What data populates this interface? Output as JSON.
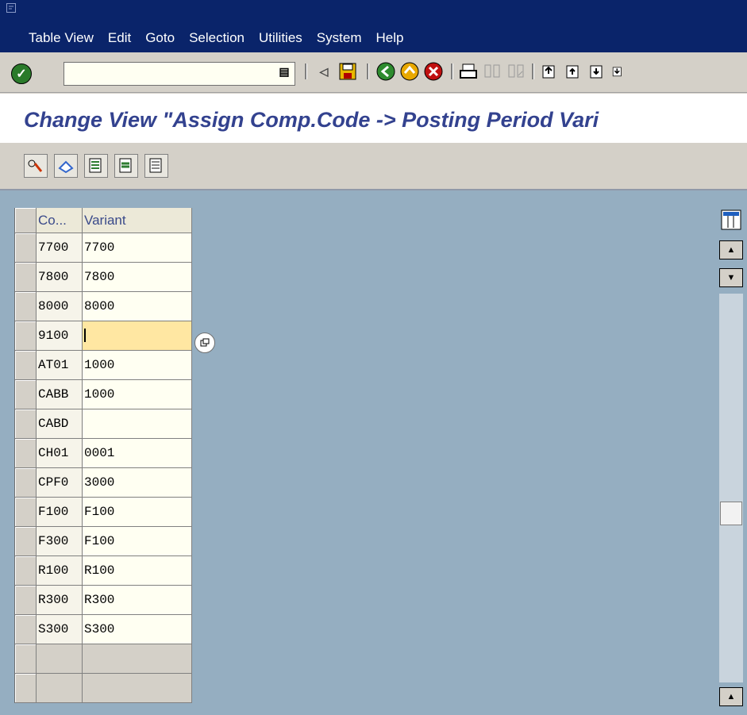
{
  "menubar": {
    "items": [
      "Table View",
      "Edit",
      "Goto",
      "Selection",
      "Utilities",
      "System",
      "Help"
    ]
  },
  "toolbar": {
    "command_value": "",
    "icons": [
      "check-icon",
      "history-icon",
      "back-triangle-icon",
      "save-icon",
      "back-icon",
      "exit-icon",
      "cancel-icon",
      "print-icon",
      "find-icon",
      "find-next-icon",
      "first-page-icon",
      "prev-page-icon",
      "next-page-icon",
      "last-page-icon"
    ]
  },
  "title": "Change View \"Assign Comp.Code -> Posting Period Vari",
  "app_toolbar": {
    "icons": [
      "edit-glasses-icon",
      "undo-icon",
      "select-all-icon",
      "select-block-icon",
      "deselect-all-icon"
    ]
  },
  "table": {
    "headers": [
      "Co...",
      "Variant"
    ],
    "rows": [
      [
        "7700",
        "7700"
      ],
      [
        "7800",
        "7800"
      ],
      [
        "8000",
        "8000"
      ],
      [
        "9100",
        ""
      ],
      [
        "AT01",
        "1000"
      ],
      [
        "CABB",
        "1000"
      ],
      [
        "CABD",
        ""
      ],
      [
        "CH01",
        "0001"
      ],
      [
        "CPF0",
        "3000"
      ],
      [
        "F100",
        "F100"
      ],
      [
        "F300",
        "F100"
      ],
      [
        "R100",
        "R100"
      ],
      [
        "R300",
        "R300"
      ],
      [
        "S300",
        "S300"
      ],
      [
        "",
        ""
      ],
      [
        "",
        ""
      ]
    ]
  },
  "colors": {
    "menubar": "#0a246a",
    "title_text": "#33428f",
    "work_area": "#95aec1",
    "focused_cell": "#ffe7a2"
  }
}
